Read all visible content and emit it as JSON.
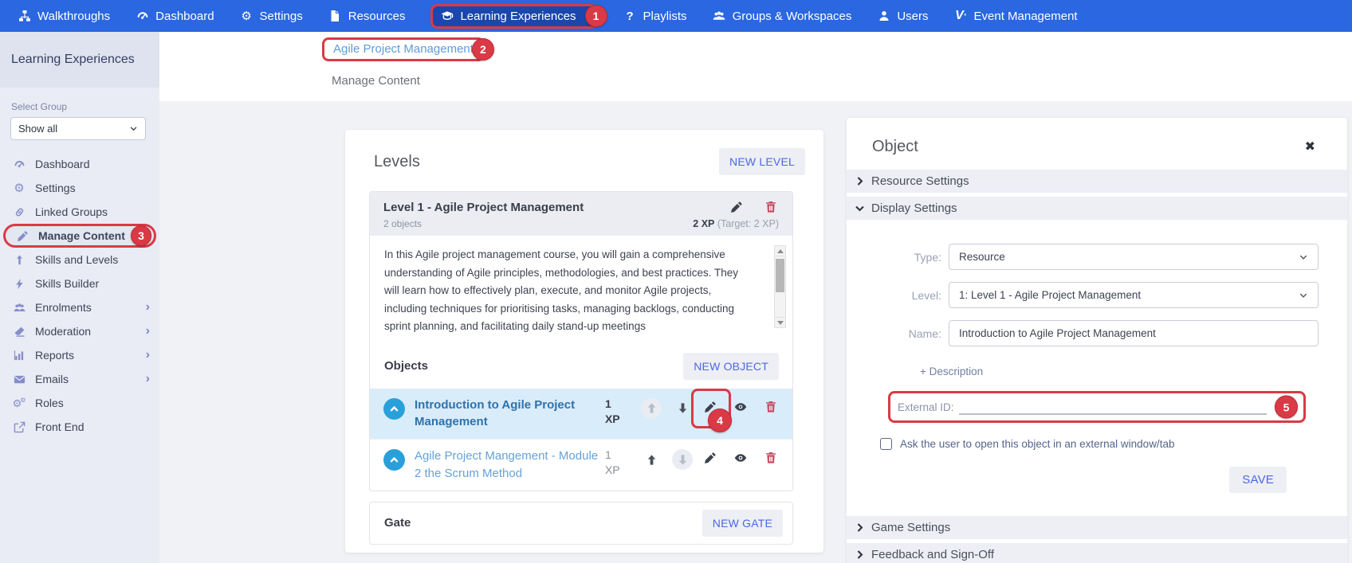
{
  "annotations": {
    "steps": [
      "1",
      "2",
      "3",
      "4",
      "5"
    ]
  },
  "topnav": {
    "items": [
      {
        "label": "Walkthroughs",
        "icon": "sitemap-icon"
      },
      {
        "label": "Dashboard",
        "icon": "dashboard-icon"
      },
      {
        "label": "Settings",
        "icon": "gear-icon"
      },
      {
        "label": "Resources",
        "icon": "file-icon"
      },
      {
        "label": "Learning Experiences",
        "icon": "graduation-cap-icon",
        "active": true,
        "badge": "1"
      },
      {
        "label": "Playlists",
        "icon": "playlists-icon"
      },
      {
        "label": "Groups & Workspaces",
        "icon": "users-icon"
      },
      {
        "label": "Users",
        "icon": "user-icon"
      },
      {
        "label": "Event Management",
        "icon": "v-logo-icon"
      }
    ]
  },
  "sidebar": {
    "title": "Learning Experiences",
    "select_group_label": "Select Group",
    "group_select_value": "Show all",
    "items": [
      {
        "label": "Dashboard",
        "icon": "dashboard-icon"
      },
      {
        "label": "Settings",
        "icon": "gear-icon"
      },
      {
        "label": "Linked Groups",
        "icon": "link-icon"
      },
      {
        "label": "Manage Content",
        "icon": "pencil-icon",
        "highlighted": true,
        "badge": "3"
      },
      {
        "label": "Skills and Levels",
        "icon": "arrow-up-icon"
      },
      {
        "label": "Skills Builder",
        "icon": "bolt-icon"
      },
      {
        "label": "Enrolments",
        "icon": "users-icon",
        "expandable": true
      },
      {
        "label": "Moderation",
        "icon": "eraser-icon",
        "expandable": true
      },
      {
        "label": "Reports",
        "icon": "bar-chart-icon",
        "expandable": true
      },
      {
        "label": "Emails",
        "icon": "envelope-icon",
        "expandable": true
      },
      {
        "label": "Roles",
        "icon": "gears-icon"
      },
      {
        "label": "Front End",
        "icon": "external-link-icon"
      }
    ]
  },
  "breadcrumb": {
    "link": "Agile Project Management",
    "badge": "2",
    "page": "Manage Content"
  },
  "levels_panel": {
    "title": "Levels",
    "new_level_button": "NEW LEVEL",
    "level": {
      "title": "Level 1 - Agile Project Management",
      "objects_count": "2 objects",
      "xp": "2 XP",
      "xp_target": " (Target: 2 XP)",
      "description": "In this Agile project management course, you will gain a comprehensive understanding of Agile principles, methodologies, and best practices. They will learn how to effectively plan, execute, and monitor Agile projects, including techniques for prioritising tasks, managing backlogs, conducting sprint planning, and facilitating daily stand-up meetings"
    },
    "objects_heading": "Objects",
    "new_object_button": "NEW OBJECT",
    "objects": [
      {
        "title": "Introduction to Agile Project Management",
        "xp_value": "1",
        "xp_label": "XP",
        "badge": "4",
        "highlighted": true
      },
      {
        "title": "Agile Project Mangement - Module 2 the Scrum Method",
        "xp_value": "1",
        "xp_label": "XP"
      }
    ],
    "gate_heading": "Gate",
    "new_gate_button": "NEW GATE"
  },
  "object_panel": {
    "title": "Object",
    "sections": {
      "resource_settings": "Resource Settings",
      "display_settings": "Display Settings",
      "game_settings": "Game Settings",
      "feedback": "Feedback and Sign-Off"
    },
    "fields": {
      "type_label": "Type:",
      "type_value": "Resource",
      "level_label": "Level:",
      "level_value": "1: Level 1 - Agile Project Management",
      "name_label": "Name:",
      "name_value": "Introduction to Agile Project Management",
      "description_link": "+ Description",
      "external_id_label": "External ID:",
      "external_id_value": "",
      "checkbox_label": "Ask the user to open this object in an external window/tab"
    },
    "save_button": "SAVE"
  },
  "colors": {
    "nav_background": "#2a67e0",
    "nav_active": "#1a47ad",
    "annotation_red": "#d93a45",
    "accent_blue": "#4d67e2",
    "row_highlight": "#d9ecfa",
    "sidebar_background": "#e9ecf4"
  }
}
